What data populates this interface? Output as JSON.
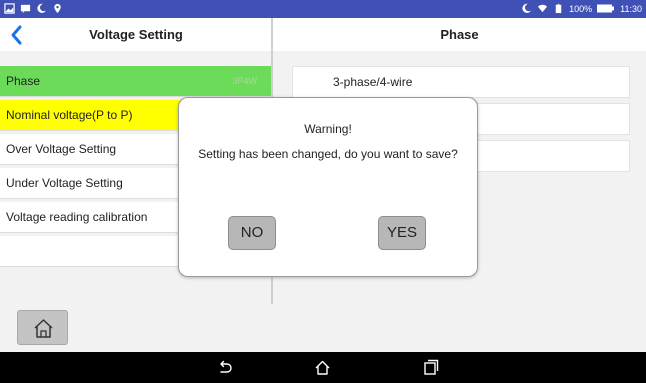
{
  "status_bar": {
    "battery_percent": "100%",
    "time": "11:30",
    "icons": [
      "gallery-icon",
      "message-icon",
      "moon-icon",
      "location-icon",
      "wifi-icon",
      "battery-saver-icon",
      "battery-icon"
    ]
  },
  "header": {
    "title": "Voltage Setting",
    "right_title": "Phase"
  },
  "menu": {
    "items": [
      {
        "label": "Phase",
        "value": "3P4W",
        "state": "selected",
        "color": "#6cdb5a"
      },
      {
        "label": "Nominal voltage(P to P)",
        "value": "",
        "state": "highlighted",
        "color": "#ffff00"
      },
      {
        "label": "Over Voltage Setting",
        "value": "",
        "state": "normal",
        "color": "#ffffff"
      },
      {
        "label": "Under Voltage Setting",
        "value": "",
        "state": "normal",
        "color": "#ffffff"
      },
      {
        "label": "Voltage reading calibration",
        "value": "",
        "state": "normal",
        "color": "#ffffff"
      }
    ]
  },
  "options": {
    "items": [
      {
        "label": "3-phase/4-wire"
      },
      {
        "label": ""
      },
      {
        "label": ""
      }
    ]
  },
  "dialog": {
    "title": "Warning!",
    "message": "Setting has been changed, do you want to save?",
    "no_label": "NO",
    "yes_label": "YES"
  },
  "nav": {
    "icons": [
      "back-icon",
      "home-icon",
      "recents-icon"
    ]
  },
  "colors": {
    "status_bar": "#3f51b5",
    "selected": "#6cdb5a",
    "highlight": "#ffff00",
    "accent": "#1a73e8"
  }
}
